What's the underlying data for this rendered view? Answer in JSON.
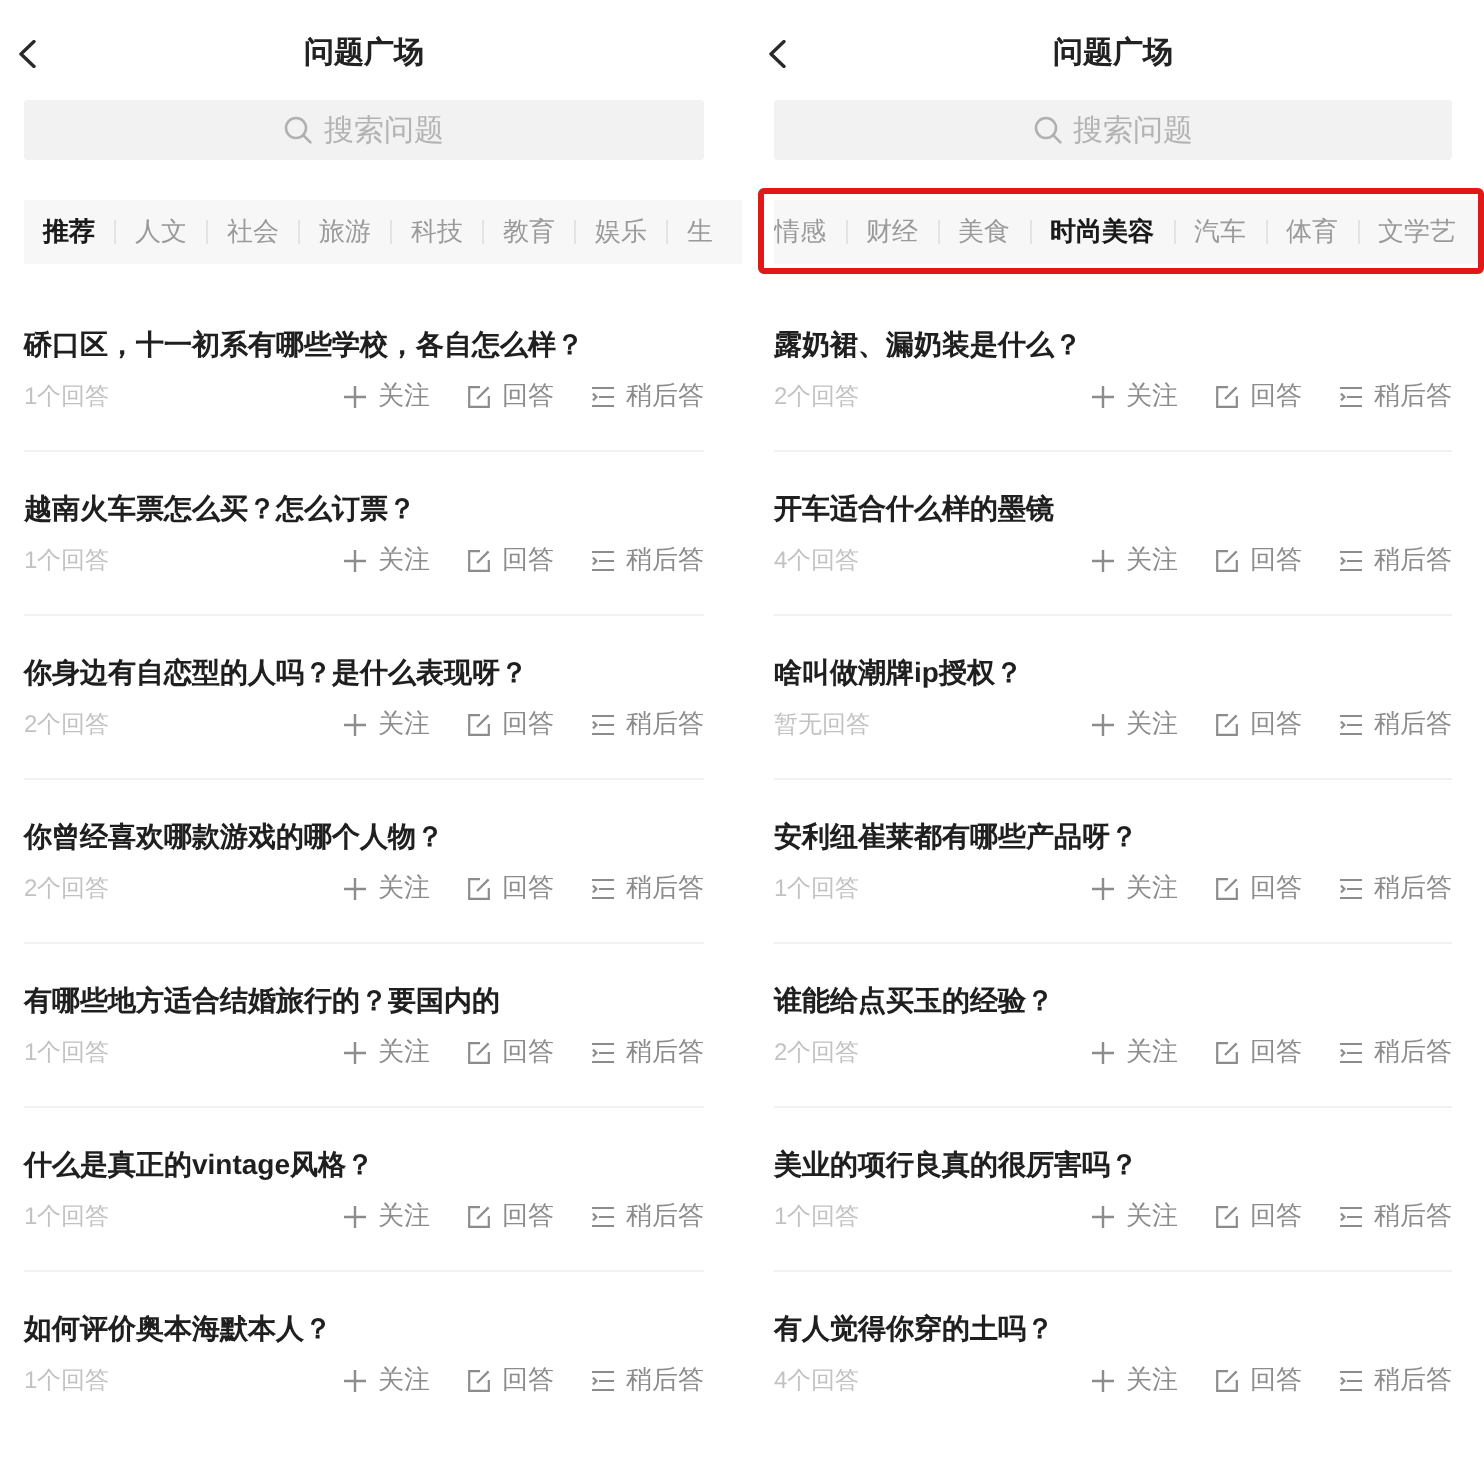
{
  "panels": [
    {
      "header": {
        "title": "问题广场"
      },
      "search": {
        "placeholder": "搜索问题"
      },
      "tabs": {
        "highlighted": false,
        "items": [
          {
            "label": "推荐",
            "selected": true
          },
          {
            "label": "人文",
            "selected": false
          },
          {
            "label": "社会",
            "selected": false
          },
          {
            "label": "旅游",
            "selected": false
          },
          {
            "label": "科技",
            "selected": false
          },
          {
            "label": "教育",
            "selected": false
          },
          {
            "label": "娱乐",
            "selected": false
          },
          {
            "label": "生",
            "selected": false
          }
        ]
      },
      "questions": [
        {
          "title": "硚口区，十一初系有哪些学校，各自怎么样？",
          "answers": "1个回答",
          "actions": [
            {
              "kind": "follow",
              "label": "关注"
            },
            {
              "kind": "answer",
              "label": "回答"
            },
            {
              "kind": "later",
              "label": "稍后答"
            }
          ]
        },
        {
          "title": "越南火车票怎么买？怎么订票？",
          "answers": "1个回答",
          "actions": [
            {
              "kind": "follow",
              "label": "关注"
            },
            {
              "kind": "answer",
              "label": "回答"
            },
            {
              "kind": "later",
              "label": "稍后答"
            }
          ]
        },
        {
          "title": "你身边有自恋型的人吗？是什么表现呀？",
          "answers": "2个回答",
          "actions": [
            {
              "kind": "follow",
              "label": "关注"
            },
            {
              "kind": "answer",
              "label": "回答"
            },
            {
              "kind": "later",
              "label": "稍后答"
            }
          ]
        },
        {
          "title": "你曾经喜欢哪款游戏的哪个人物？",
          "answers": "2个回答",
          "actions": [
            {
              "kind": "follow",
              "label": "关注"
            },
            {
              "kind": "answer",
              "label": "回答"
            },
            {
              "kind": "later",
              "label": "稍后答"
            }
          ]
        },
        {
          "title": "有哪些地方适合结婚旅行的？要国内的",
          "answers": "1个回答",
          "actions": [
            {
              "kind": "follow",
              "label": "关注"
            },
            {
              "kind": "answer",
              "label": "回答"
            },
            {
              "kind": "later",
              "label": "稍后答"
            }
          ]
        },
        {
          "title": "什么是真正的vintage风格？",
          "answers": "1个回答",
          "actions": [
            {
              "kind": "follow",
              "label": "关注"
            },
            {
              "kind": "answer",
              "label": "回答"
            },
            {
              "kind": "later",
              "label": "稍后答"
            }
          ]
        },
        {
          "title": "如何评价奥本海默本人？",
          "answers": "1个回答",
          "actions": [
            {
              "kind": "follow",
              "label": "关注"
            },
            {
              "kind": "answer",
              "label": "回答"
            },
            {
              "kind": "later",
              "label": "稍后答"
            }
          ]
        }
      ]
    },
    {
      "header": {
        "title": "问题广场"
      },
      "search": {
        "placeholder": "搜索问题"
      },
      "tabs": {
        "highlighted": true,
        "items": [
          {
            "label": "情感",
            "selected": false
          },
          {
            "label": "财经",
            "selected": false
          },
          {
            "label": "美食",
            "selected": false
          },
          {
            "label": "时尚美容",
            "selected": true
          },
          {
            "label": "汽车",
            "selected": false
          },
          {
            "label": "体育",
            "selected": false
          },
          {
            "label": "文学艺",
            "selected": false
          }
        ]
      },
      "questions": [
        {
          "title": "露奶裙、漏奶装是什么？",
          "answers": "2个回答",
          "actions": [
            {
              "kind": "follow",
              "label": "关注"
            },
            {
              "kind": "answer",
              "label": "回答"
            },
            {
              "kind": "later",
              "label": "稍后答"
            }
          ]
        },
        {
          "title": "开车适合什么样的墨镜",
          "answers": "4个回答",
          "actions": [
            {
              "kind": "follow",
              "label": "关注"
            },
            {
              "kind": "answer",
              "label": "回答"
            },
            {
              "kind": "later",
              "label": "稍后答"
            }
          ]
        },
        {
          "title": "啥叫做潮牌ip授权？",
          "answers": "暂无回答",
          "actions": [
            {
              "kind": "follow",
              "label": "关注"
            },
            {
              "kind": "answer",
              "label": "回答"
            },
            {
              "kind": "later",
              "label": "稍后答"
            }
          ]
        },
        {
          "title": "安利纽崔莱都有哪些产品呀？",
          "answers": "1个回答",
          "actions": [
            {
              "kind": "follow",
              "label": "关注"
            },
            {
              "kind": "answer",
              "label": "回答"
            },
            {
              "kind": "later",
              "label": "稍后答"
            }
          ]
        },
        {
          "title": "谁能给点买玉的经验？",
          "answers": "2个回答",
          "actions": [
            {
              "kind": "follow",
              "label": "关注"
            },
            {
              "kind": "answer",
              "label": "回答"
            },
            {
              "kind": "later",
              "label": "稍后答"
            }
          ]
        },
        {
          "title": "美业的项行良真的很厉害吗？",
          "answers": "1个回答",
          "actions": [
            {
              "kind": "follow",
              "label": "关注"
            },
            {
              "kind": "answer",
              "label": "回答"
            },
            {
              "kind": "later",
              "label": "稍后答"
            }
          ]
        },
        {
          "title": "有人觉得你穿的土吗？",
          "answers": "4个回答",
          "actions": [
            {
              "kind": "follow",
              "label": "关注"
            },
            {
              "kind": "answer",
              "label": "回答"
            },
            {
              "kind": "later",
              "label": "稍后答"
            }
          ]
        }
      ]
    }
  ]
}
